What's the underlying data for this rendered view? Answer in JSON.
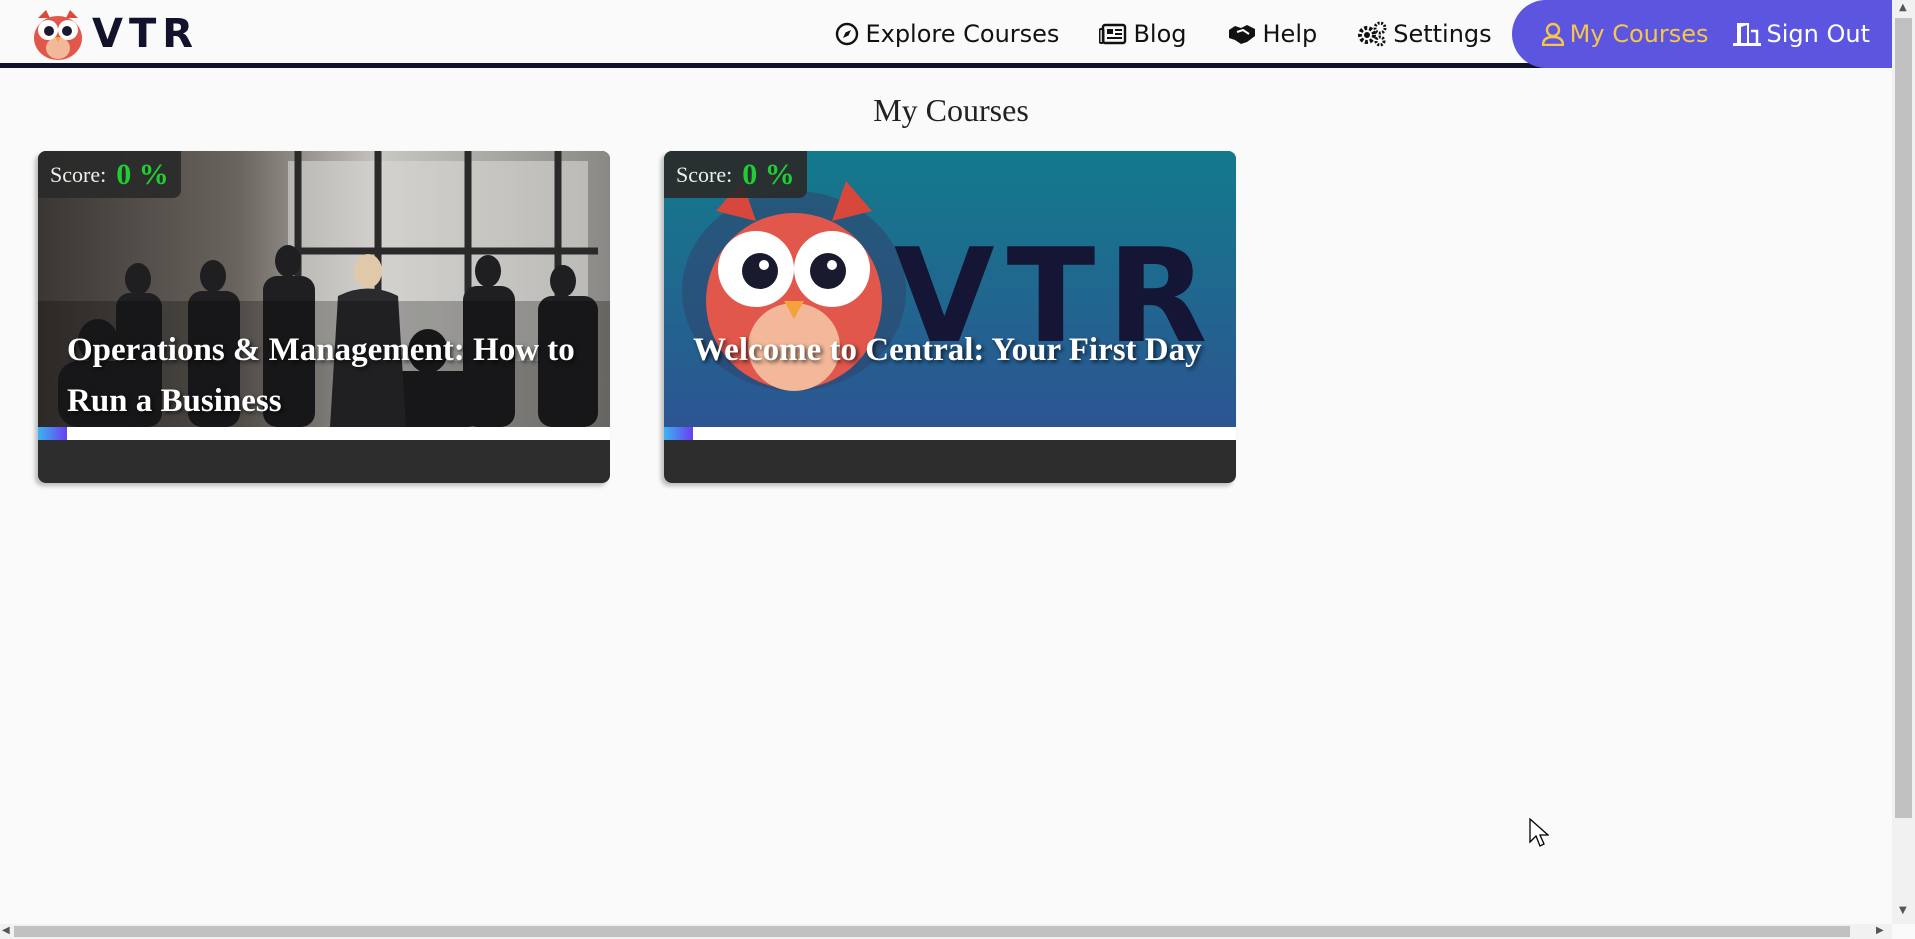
{
  "brand": {
    "name": "VTR",
    "accent": "#5b55e0",
    "active_color": "#f5c64a",
    "dark": "#12122c"
  },
  "nav": {
    "explore": "Explore Courses",
    "blog": "Blog",
    "help": "Help",
    "settings": "Settings",
    "my_courses": "My Courses",
    "sign_out": "Sign Out"
  },
  "page": {
    "title": "My Courses"
  },
  "courses": [
    {
      "title": "Operations & Management: How to Run a Business",
      "score_label": "Score:",
      "score": "0 %",
      "progress": 0.05
    },
    {
      "title": "Welcome to Central: Your First Day",
      "score_label": "Score:",
      "score": "0 %",
      "progress": 0.05
    }
  ]
}
